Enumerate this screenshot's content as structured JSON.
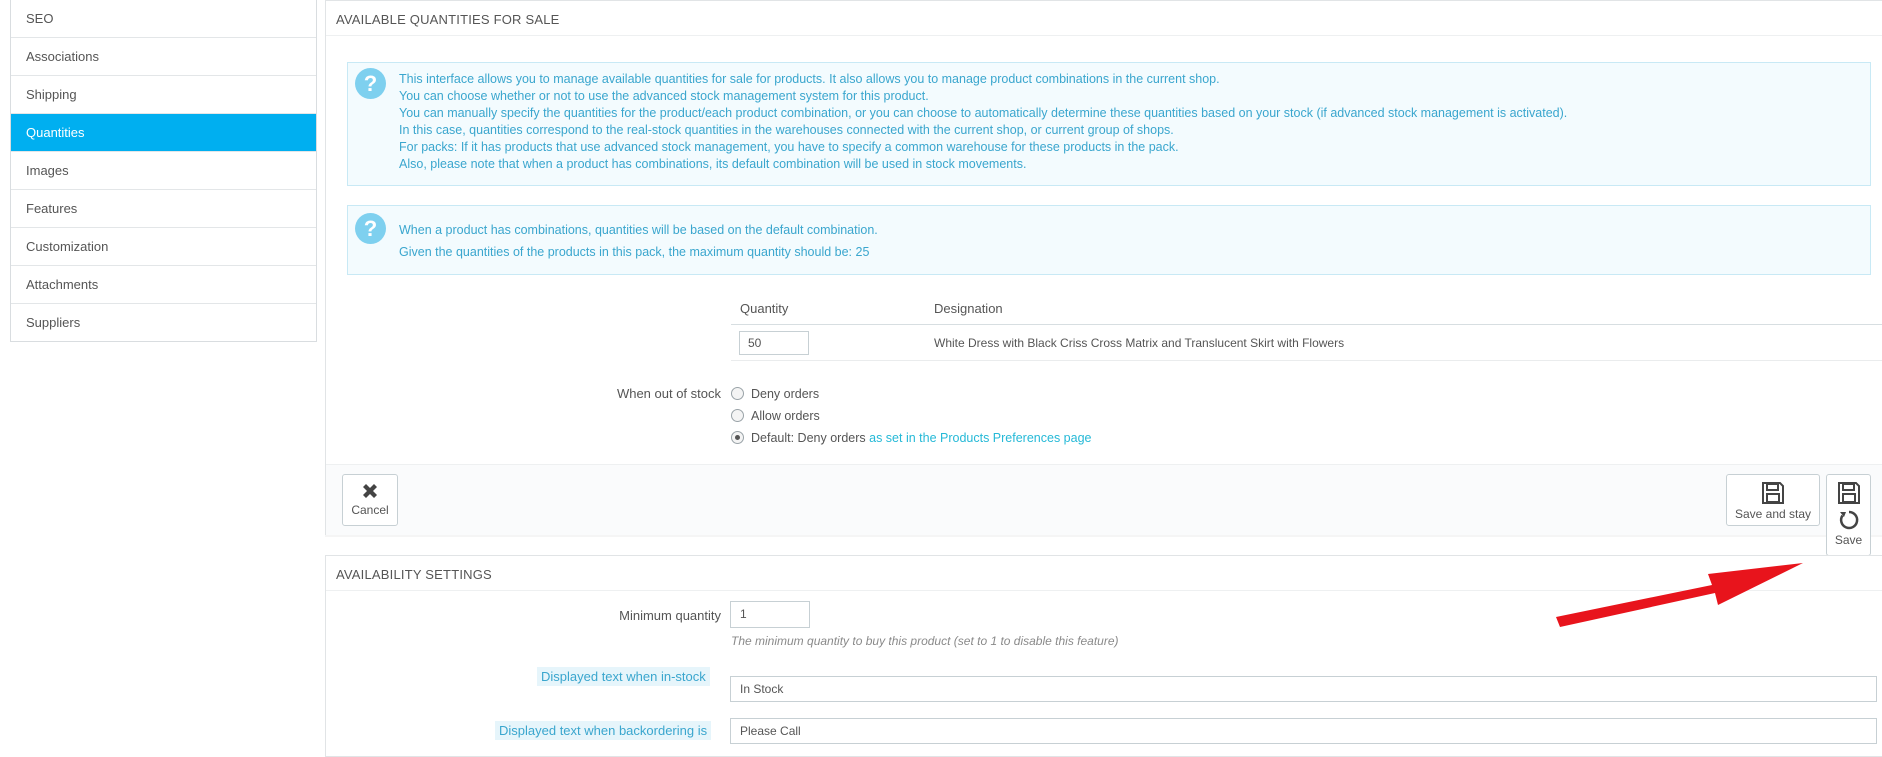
{
  "sidebar": {
    "items": [
      {
        "label": "SEO",
        "active": false
      },
      {
        "label": "Associations",
        "active": false
      },
      {
        "label": "Shipping",
        "active": false
      },
      {
        "label": "Quantities",
        "active": true
      },
      {
        "label": "Images",
        "active": false
      },
      {
        "label": "Features",
        "active": false
      },
      {
        "label": "Customization",
        "active": false
      },
      {
        "label": "Attachments",
        "active": false
      },
      {
        "label": "Suppliers",
        "active": false
      }
    ]
  },
  "quantities_panel": {
    "heading": "AVAILABLE QUANTITIES FOR SALE",
    "info_lines": [
      "This interface allows you to manage available quantities for sale for products. It also allows you to manage product combinations in the current shop.",
      "You can choose whether or not to use the advanced stock management system for this product.",
      "You can manually specify the quantities for the product/each product combination, or you can choose to automatically determine these quantities based on your stock (if advanced stock management is activated).",
      "In this case, quantities correspond to the real-stock quantities in the warehouses connected with the current shop, or current group of shops.",
      "For packs: If it has products that use advanced stock management, you have to specify a common warehouse for these products in the pack.",
      "Also, please note that when a product has combinations, its default combination will be used in stock movements."
    ],
    "pack_lines": [
      "When a product has combinations, quantities will be based on the default combination.",
      "Given the quantities of the products in this pack, the maximum quantity should be: 25"
    ],
    "table": {
      "col_quantity": "Quantity",
      "col_designation": "Designation",
      "rows": [
        {
          "quantity": "50",
          "designation": "White Dress with Black Criss Cross Matrix and Translucent Skirt with Flowers"
        }
      ]
    },
    "out_of_stock": {
      "label": "When out of stock",
      "options": [
        {
          "label": "Deny orders",
          "checked": false
        },
        {
          "label": "Allow orders",
          "checked": false
        },
        {
          "label": "Default: Deny orders",
          "checked": true
        }
      ],
      "default_link": "as set in the Products Preferences page"
    },
    "footer": {
      "cancel_label": "Cancel",
      "save_stay_label": "Save and stay",
      "save_label": "Save"
    }
  },
  "availability_panel": {
    "heading": "AVAILABILITY SETTINGS",
    "min_qty_label": "Minimum quantity",
    "min_qty_value": "1",
    "min_qty_hint": "The minimum quantity to buy this product (set to 1 to disable this feature)",
    "in_stock_label": "Displayed text when in-stock",
    "in_stock_value": "In Stock",
    "backorder_label": "Displayed text when backordering is",
    "backorder_value": "Please Call"
  },
  "colors": {
    "accent": "#00aff0",
    "info_text": "#3aa6ce",
    "annotation_arrow": "#e8141c"
  }
}
